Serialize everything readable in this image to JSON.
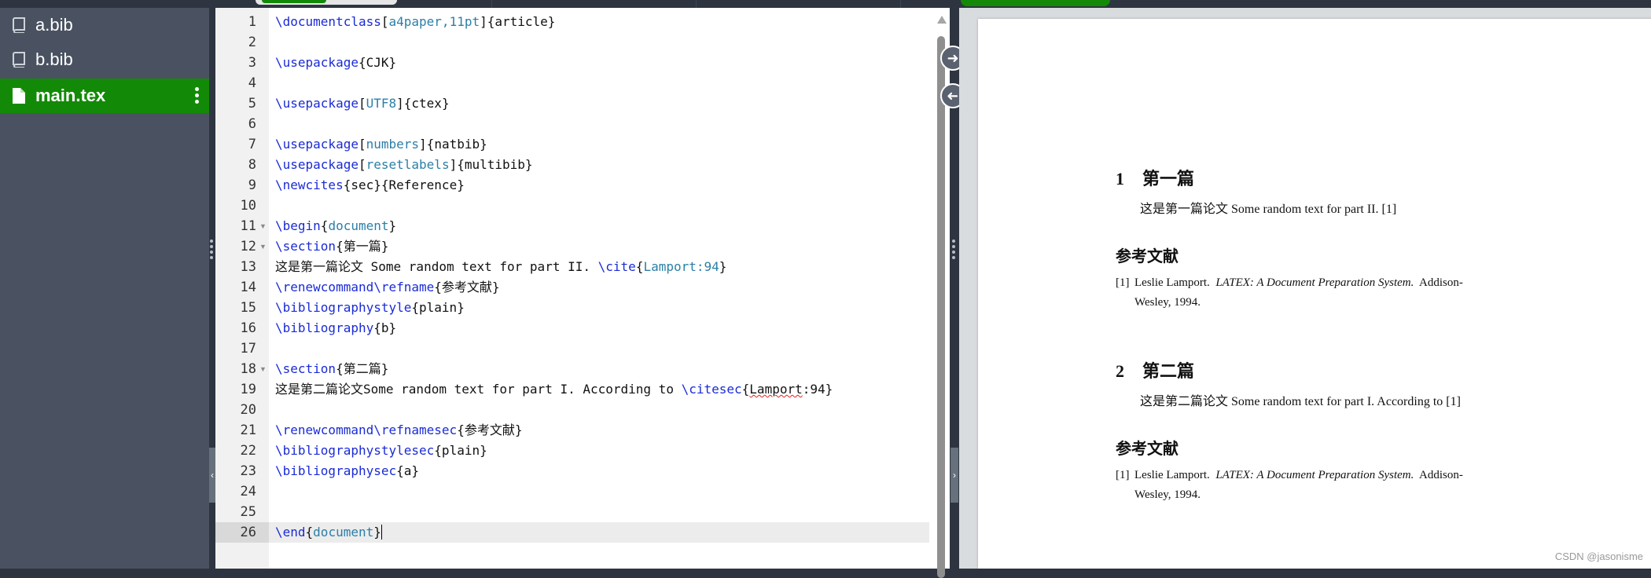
{
  "files": [
    {
      "name": "a.bib",
      "icon": "book-icon",
      "active": false
    },
    {
      "name": "b.bib",
      "icon": "book-icon",
      "active": false
    },
    {
      "name": "main.tex",
      "icon": "file-icon",
      "active": true
    }
  ],
  "editor": {
    "current_line": 26,
    "lines": [
      {
        "n": "1",
        "segs": [
          [
            "kw",
            "\\documentclass"
          ],
          [
            "",
            "["
          ],
          [
            "arg",
            "a4paper,11pt"
          ],
          [
            "",
            "]{article}"
          ]
        ]
      },
      {
        "n": "2",
        "segs": []
      },
      {
        "n": "3",
        "segs": [
          [
            "kw",
            "\\usepackage"
          ],
          [
            "",
            "{CJK}"
          ]
        ]
      },
      {
        "n": "4",
        "segs": []
      },
      {
        "n": "5",
        "segs": [
          [
            "kw",
            "\\usepackage"
          ],
          [
            "",
            "["
          ],
          [
            "arg",
            "UTF8"
          ],
          [
            "",
            "]{ctex}"
          ]
        ]
      },
      {
        "n": "6",
        "segs": []
      },
      {
        "n": "7",
        "segs": [
          [
            "kw",
            "\\usepackage"
          ],
          [
            "",
            "["
          ],
          [
            "arg",
            "numbers"
          ],
          [
            "",
            "]{natbib}"
          ]
        ]
      },
      {
        "n": "8",
        "segs": [
          [
            "kw",
            "\\usepackage"
          ],
          [
            "",
            "["
          ],
          [
            "arg",
            "resetlabels"
          ],
          [
            "",
            "]{multibib}"
          ]
        ]
      },
      {
        "n": "9",
        "segs": [
          [
            "kw",
            "\\newcites"
          ],
          [
            "",
            "{sec}{Reference}"
          ]
        ]
      },
      {
        "n": "10",
        "segs": []
      },
      {
        "n": "11",
        "fold": true,
        "segs": [
          [
            "kw",
            "\\begin"
          ],
          [
            "",
            "{"
          ],
          [
            "arg",
            "document"
          ],
          [
            "",
            "}"
          ]
        ]
      },
      {
        "n": "12",
        "fold": true,
        "segs": [
          [
            "kw",
            "\\section"
          ],
          [
            "",
            "{第一篇}"
          ]
        ]
      },
      {
        "n": "13",
        "segs": [
          [
            "",
            "这是第一篇论文 Some random text for part II. "
          ],
          [
            "kw",
            "\\cite"
          ],
          [
            "",
            "{"
          ],
          [
            "arg",
            "Lamport:94"
          ],
          [
            "",
            "}"
          ]
        ]
      },
      {
        "n": "14",
        "segs": [
          [
            "kw",
            "\\renewcommand\\refname"
          ],
          [
            "",
            "{参考文献}"
          ]
        ]
      },
      {
        "n": "15",
        "segs": [
          [
            "kw",
            "\\bibliographystyle"
          ],
          [
            "",
            "{plain}"
          ]
        ]
      },
      {
        "n": "16",
        "segs": [
          [
            "kw",
            "\\bibliography"
          ],
          [
            "",
            "{b}"
          ]
        ]
      },
      {
        "n": "17",
        "segs": []
      },
      {
        "n": "18",
        "fold": true,
        "segs": [
          [
            "kw",
            "\\section"
          ],
          [
            "",
            "{第二篇}"
          ]
        ]
      },
      {
        "n": "19",
        "segs": [
          [
            "",
            "这是第二篇论文Some random text for part I. According to "
          ],
          [
            "kw",
            "\\citesec"
          ],
          [
            "",
            "{"
          ],
          [
            "spell",
            "Lamport"
          ],
          [
            "",
            ":94}"
          ]
        ]
      },
      {
        "n": "20",
        "segs": []
      },
      {
        "n": "21",
        "segs": [
          [
            "kw",
            "\\renewcommand\\refnamesec"
          ],
          [
            "",
            "{参考文献}"
          ]
        ]
      },
      {
        "n": "22",
        "segs": [
          [
            "kw",
            "\\bibliographystylesec"
          ],
          [
            "",
            "{plain}"
          ]
        ]
      },
      {
        "n": "23",
        "segs": [
          [
            "kw",
            "\\bibliographysec"
          ],
          [
            "",
            "{a}"
          ]
        ]
      },
      {
        "n": "24",
        "segs": []
      },
      {
        "n": "25",
        "segs": []
      },
      {
        "n": "26",
        "segs": [
          [
            "kw",
            "\\end"
          ],
          [
            "",
            "{"
          ],
          [
            "arg",
            "document"
          ],
          [
            "",
            "}"
          ]
        ]
      }
    ]
  },
  "preview": {
    "sections": [
      {
        "num": "1",
        "title": "第一篇",
        "body": "这是第一篇论文 Some random text for part II. [1]",
        "ref_heading": "参考文献",
        "ref_num": "[1]",
        "ref_line1_pre": "Leslie Lamport.  ",
        "ref_line1_italic": "LATEX: A Document Preparation System.",
        "ref_line1_post": "  Addison-",
        "ref_line2": "Wesley, 1994."
      },
      {
        "num": "2",
        "title": "第二篇",
        "body": "这是第二篇论文 Some random text for part I. According to [1]",
        "ref_heading": "参考文献",
        "ref_num": "[1]",
        "ref_line1_pre": "Leslie Lamport.  ",
        "ref_line1_italic": "LATEX: A Document Preparation System.",
        "ref_line1_post": "  Addison-",
        "ref_line2": "Wesley, 1994."
      }
    ],
    "watermark": "CSDN @jasonisme"
  },
  "colors": {
    "accent_green": "#138a07",
    "sidebar_bg": "#4a5261",
    "keyword_blue": "#1a2bd6",
    "argument_teal": "#2b7fa7"
  }
}
